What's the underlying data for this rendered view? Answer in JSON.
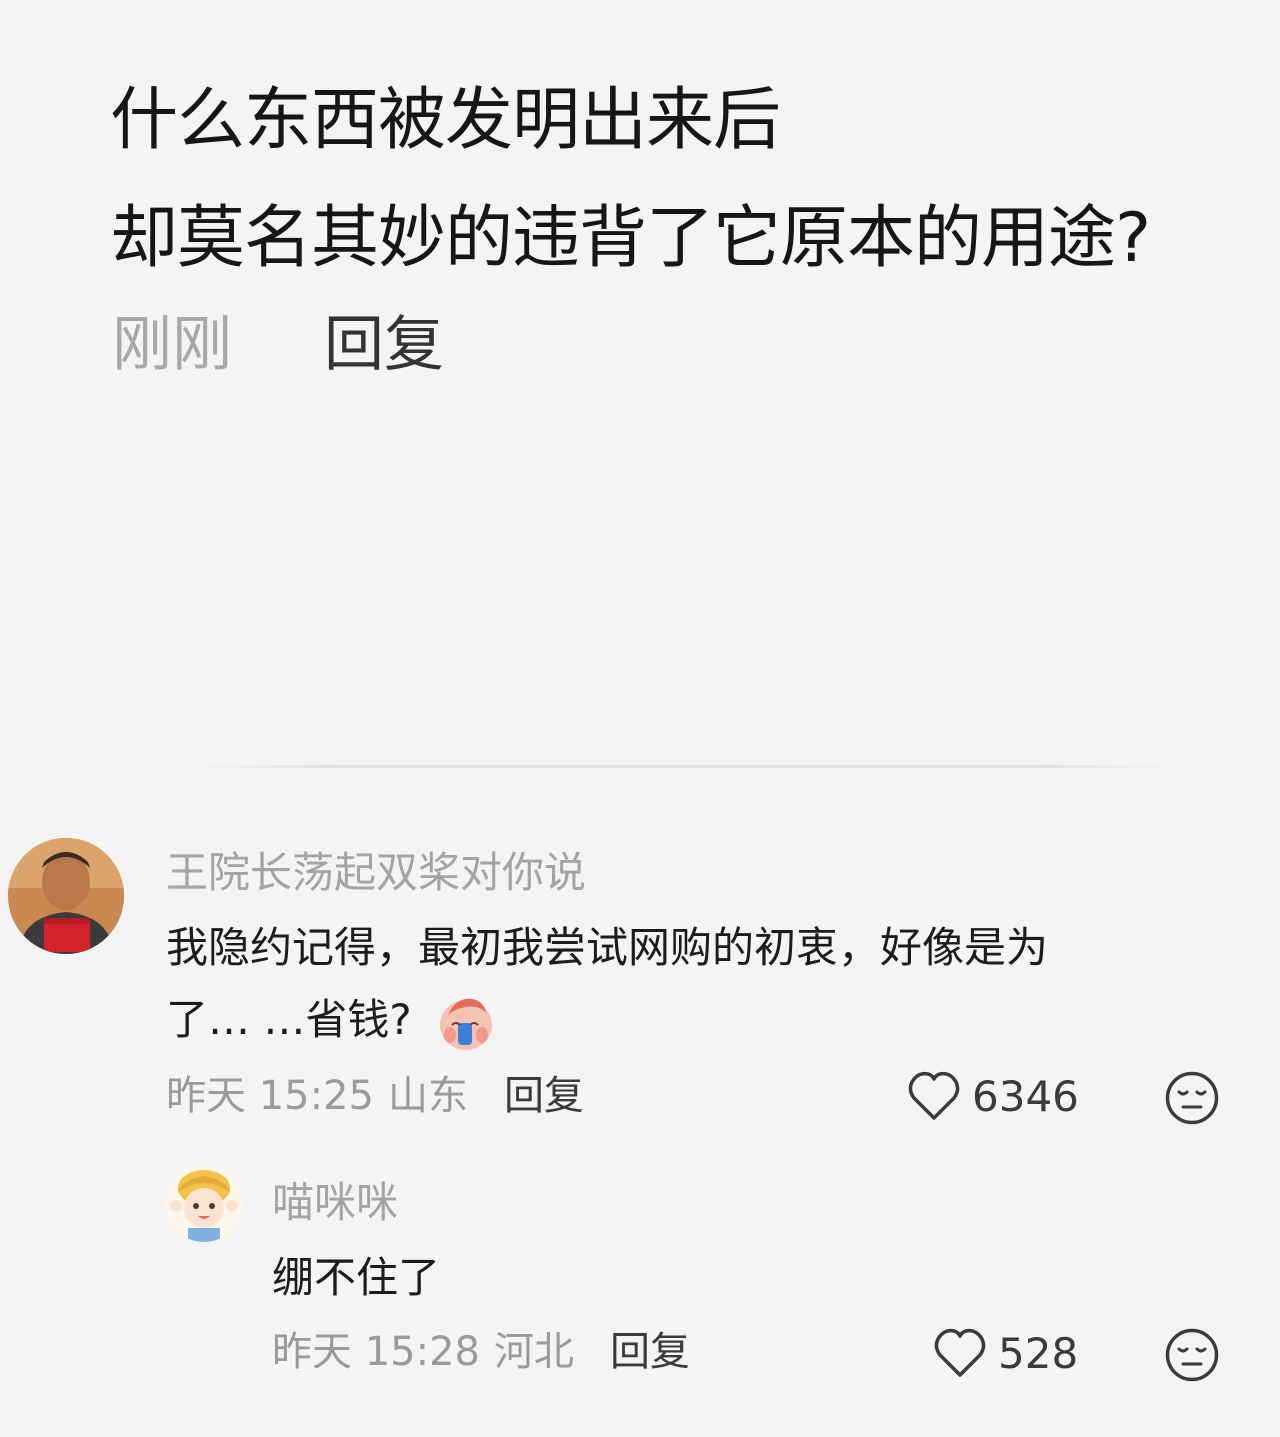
{
  "post": {
    "title_line1": "什么东西被发明出来后",
    "title_line2": "却莫名其妙的违背了它原本的用途?",
    "time": "刚刚",
    "reply_label": "回复"
  },
  "comments": [
    {
      "username": "王院长荡起双桨对你说",
      "avatar_icon": "avatar-man-photo",
      "text_line1": "我隐约记得，最初我尝试网购的初衷，好像是为",
      "text_line2": "了… …省钱?",
      "emoji_icon": "crying-emoji",
      "time": "昨天 15:25",
      "location": "山东",
      "reply_label": "回复",
      "likes": "6346",
      "reaction_icon": "neutral-face-icon"
    },
    {
      "username": "喵咪咪",
      "avatar_icon": "avatar-cartoon-girl",
      "text": "绷不住了",
      "time": "昨天 15:28",
      "location": "河北",
      "reply_label": "回复",
      "likes": "528",
      "reaction_icon": "neutral-face-icon"
    }
  ],
  "colors": {
    "background": "#f4f4f4",
    "text_primary": "#1c1c1c",
    "text_muted": "#a4a4a4"
  }
}
